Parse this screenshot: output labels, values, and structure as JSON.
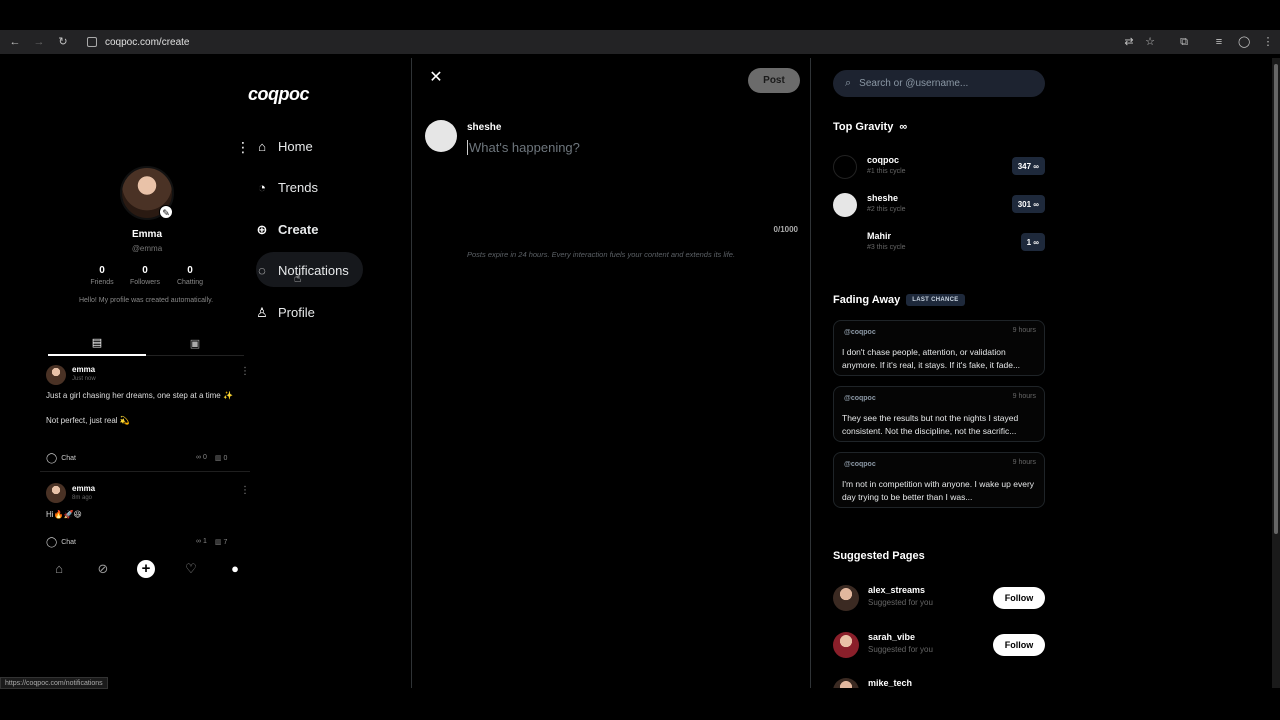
{
  "browser": {
    "url": "coqpoc.com/create",
    "status_url": "https://coqpoc.com/notifications"
  },
  "brand": {
    "logo": "coqpoc"
  },
  "nav": {
    "items": [
      {
        "label": "Home",
        "icon": "home-icon"
      },
      {
        "label": "Trends",
        "icon": "trends-icon"
      },
      {
        "label": "Create",
        "icon": "create-icon"
      },
      {
        "label": "Notifications",
        "icon": "notifications-icon"
      },
      {
        "label": "Profile",
        "icon": "profile-icon"
      }
    ]
  },
  "profile": {
    "name": "Emma",
    "handle": "@emma",
    "stats": [
      {
        "value": "0",
        "label": "Friends"
      },
      {
        "value": "0",
        "label": "Followers"
      },
      {
        "value": "0",
        "label": "Chatting"
      }
    ],
    "bio": "Hello! My profile was created automatically.",
    "posts": [
      {
        "user": "emma",
        "time": "Just now",
        "text1": "Just a girl chasing her dreams, one step at a time ✨",
        "text2": "Not perfect, just real 💫",
        "chat": "Chat",
        "inf": "0",
        "views": "0"
      },
      {
        "user": "emma",
        "time": "8m ago",
        "text1": "Hi🔥🚀😆",
        "text2": "",
        "chat": "Chat",
        "inf": "1",
        "views": "7"
      }
    ]
  },
  "composer": {
    "close": "✕",
    "post_label": "Post",
    "username": "sheshe",
    "placeholder": "What's happening?",
    "counter": "0/1000",
    "note": "Posts expire in 24 hours. Every interaction fuels your content and extends its life."
  },
  "sidebar": {
    "search_placeholder": "Search or @username...",
    "top_gravity": {
      "title": "Top Gravity",
      "icon": "∞",
      "items": [
        {
          "name": "coqpoc",
          "sub": "#1 this cycle",
          "score": "347 ∞"
        },
        {
          "name": "sheshe",
          "sub": "#2 this cycle",
          "score": "301 ∞"
        },
        {
          "name": "Mahir",
          "sub": "#3 this cycle",
          "score": "1 ∞"
        }
      ]
    },
    "fading_away": {
      "title": "Fading Away",
      "badge": "LAST CHANCE",
      "items": [
        {
          "handle": "@coqpoc",
          "time": "9 hours",
          "text": "I don't chase people, attention, or validation anymore. If it's real, it stays. If it's fake, it fade..."
        },
        {
          "handle": "@coqpoc",
          "time": "9 hours",
          "text": "They see the results but not the nights I stayed consistent. Not the discipline, not the sacrific..."
        },
        {
          "handle": "@coqpoc",
          "time": "9 hours",
          "text": "I'm not in competition with anyone. I wake up every day trying to be better than I was..."
        }
      ]
    },
    "suggested": {
      "title": "Suggested Pages",
      "items": [
        {
          "name": "alex_streams",
          "sub": "Suggested for you",
          "action": "Follow"
        },
        {
          "name": "sarah_vibe",
          "sub": "Suggested for you",
          "action": "Follow"
        },
        {
          "name": "mike_tech",
          "sub": "",
          "action": ""
        }
      ]
    }
  }
}
